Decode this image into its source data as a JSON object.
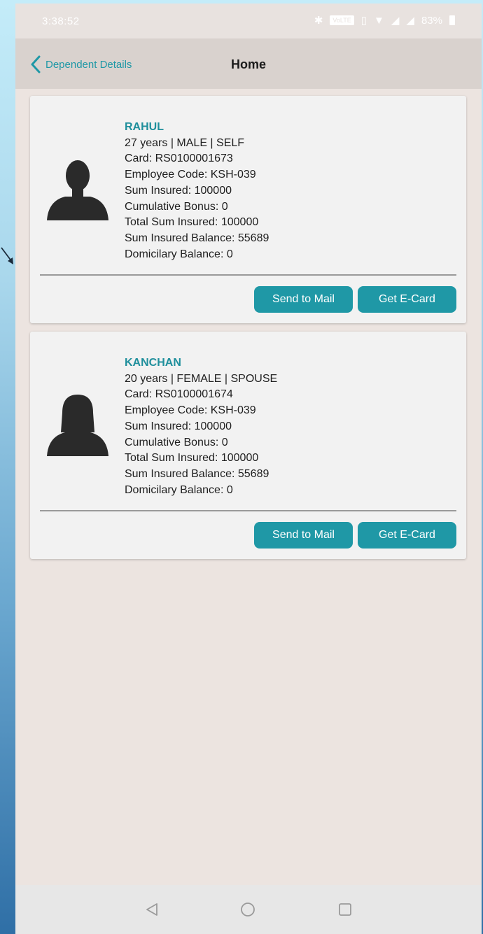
{
  "status_bar": {
    "time": "3:38:52",
    "network_chip": "VoLTE",
    "battery": "83%"
  },
  "header": {
    "back_label": "Dependent Details",
    "title": "Home"
  },
  "members": [
    {
      "name": "RAHUL",
      "demographics": "27 years | MALE | SELF",
      "card": "Card: RS0100001673",
      "employee_code": "Employee Code: KSH-039",
      "sum_insured": "Sum Insured: 100000",
      "cumulative_bonus": "Cumulative Bonus: 0",
      "total_sum_insured": "Total Sum Insured: 100000",
      "sum_insured_balance": "Sum Insured Balance: 55689",
      "domiciliary_balance": "Domicilary Balance: 0",
      "avatar": "male-avatar-icon",
      "mail_button": "Send to Mail",
      "ecard_button": "Get E-Card"
    },
    {
      "name": "KANCHAN",
      "demographics": "20 years | FEMALE | SPOUSE",
      "card": "Card: RS0100001674",
      "employee_code": "Employee Code: KSH-039",
      "sum_insured": "Sum Insured: 100000",
      "cumulative_bonus": "Cumulative Bonus: 0",
      "total_sum_insured": "Total Sum Insured: 100000",
      "sum_insured_balance": "Sum Insured Balance: 55689",
      "domiciliary_balance": "Domicilary Balance: 0",
      "avatar": "female-avatar-icon",
      "mail_button": "Send to Mail",
      "ecard_button": "Get E-Card"
    }
  ],
  "bottom_nav": {
    "back": "back-triangle-icon",
    "home": "home-circle-icon",
    "recents": "recents-square-icon"
  },
  "colors": {
    "accent": "#1f98a6",
    "name_color": "#1f8f9c",
    "card_background": "#f2f2f2",
    "page_background": "#ece4e0"
  }
}
